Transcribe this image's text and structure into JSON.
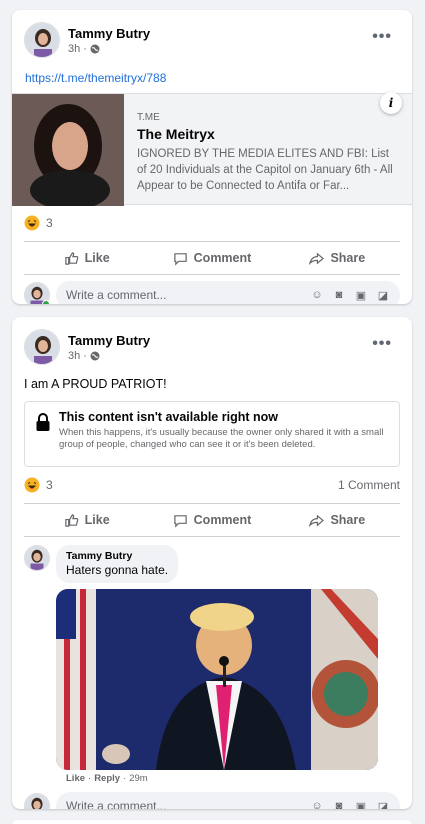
{
  "post1": {
    "author": "Tammy Butry",
    "time": "3h ·",
    "link": "https://t.me/themeitryx/788",
    "preview": {
      "domain": "T.ME",
      "title": "The Meitryx",
      "description": "IGNORED BY THE MEDIA ELITES AND FBI: List of 20 Individuals at the Capitol on January 6th - All Appear to be Connected to Antifa or Far..."
    },
    "reaction_count": "3"
  },
  "post2": {
    "author": "Tammy Butry",
    "time": "3h ·",
    "text": "I am A PROUD PATRIOT!",
    "unavailable": {
      "title": "This content isn't available right now",
      "description": "When this happens, it's usually because the owner only shared it with a small group of people, changed who can see it or it's been deleted."
    },
    "reaction_count": "3",
    "comment_count": "1 Comment",
    "comment": {
      "author": "Tammy Butry",
      "text": "Haters gonna hate.",
      "like": "Like",
      "reply": "Reply",
      "time": "29m"
    }
  },
  "actions": {
    "like": "Like",
    "comment": "Comment",
    "share": "Share"
  },
  "comment_placeholder": "Write a comment...",
  "colors": {
    "link": "#216fdb",
    "online": "#31a24c",
    "background": "#f0f2f5"
  }
}
